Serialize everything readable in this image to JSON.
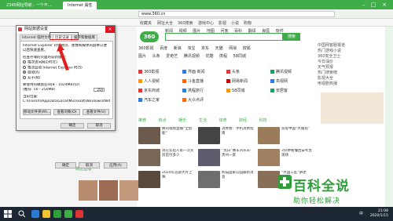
{
  "browser": {
    "tabs": [
      "2345网址导航 - 一个不…",
      "Internet 属性"
    ],
    "address_text": "www.360.cn",
    "search_button": "搜索",
    "logo": "360",
    "nav_row1": [
      "新闻",
      "视频",
      "图片",
      "地图",
      "问答",
      "百科",
      "翻译",
      "良医",
      "软件"
    ],
    "nav_row2": [
      "360影视",
      "百度",
      "新浪",
      "淘宝",
      "京东",
      "天猫",
      "网易",
      "搜狐"
    ],
    "nav_row3": [
      "图片",
      "头条",
      "爱奇艺",
      "腾讯视频",
      "优酷",
      "携程",
      "58同城"
    ],
    "grid_links": [
      "360影视",
      "界面·新闻",
      "头条",
      "腾讯视频",
      "人人视频",
      "斗鱼直播",
      "网易新闻",
      "央视网",
      "京东商城",
      "携程旅行",
      "58同城",
      "安居客",
      "汽车之家",
      "大众点评"
    ],
    "news_tabs": [
      "推荐",
      "热点",
      "娱乐",
      "生活",
      "体育",
      "财经",
      "科技"
    ],
    "news_captions": [
      "腾讯视频直播“全智能”",
      "消费者：手机消费指南",
      "游客中国“大雁塔”",
      "现在年轻人第一次买房首付多少",
      "“黑白”赛车刘乐天·贵州一景",
      "3分钟看懂西安考古现场",
      "2020年首部大片上映",
      "熊猫国家公园最新消息",
      "“大国工匠”讲述"
    ],
    "right_panel_lines": [
      "中国网客服报道",
      "热门游戏小说",
      "360安全卫士",
      "今日油价",
      "天气预报",
      "热门搜索榜",
      "影视大全",
      "电视剧热播"
    ],
    "bottom_section_title": "精选直播",
    "bookmarks": [
      "收藏夹",
      "网址大全",
      "360搜索",
      "游戏中心",
      "影视",
      "小说",
      "购物"
    ]
  },
  "dialog": {
    "title": "网站数据设置",
    "tabs": [
      "Internet 临时文件",
      "历史记录",
      "缓存和数据库"
    ],
    "active_tab_index": 1,
    "line1": "Internet Explorer 存储网页、图像和媒体的副本以便以后快速查看。",
    "check_label": "检查存储的页面的较新版本:",
    "options": [
      "每次访问网页时(E)",
      "每次启动 Internet Explorer 时(S)",
      "自动(A)",
      "从不(N)"
    ],
    "selected_option_index": 2,
    "disk_space_label": "要使用的磁盘空间(8 - 1024MB)(D)",
    "disk_space_hint": "(推荐: 50 - 250MB)",
    "disk_space_value": "250",
    "location_label": "当前位置:",
    "location_path": "C:\\Users\\ll\\AppData\\Local\\Microsoft\\Windows\\INetCache\\",
    "buttons": [
      "移动文件夹(M)...",
      "查看对象(O)",
      "查看文件(V)"
    ],
    "footer_buttons": [
      "确定",
      "取消"
    ]
  },
  "background_dialog_footer": [
    "确定",
    "取消",
    "应用(A)"
  ],
  "watermark": {
    "big": "百科全说",
    "small": "助你轻松解决"
  },
  "taskbar": {
    "time": "21:08",
    "date": "2020/1/15",
    "lang": "中"
  },
  "colors": {
    "browser_green": "#3fae49",
    "close_red": "#e81123",
    "highlight_red": "#e02020",
    "taskbar": "#1c2733"
  }
}
